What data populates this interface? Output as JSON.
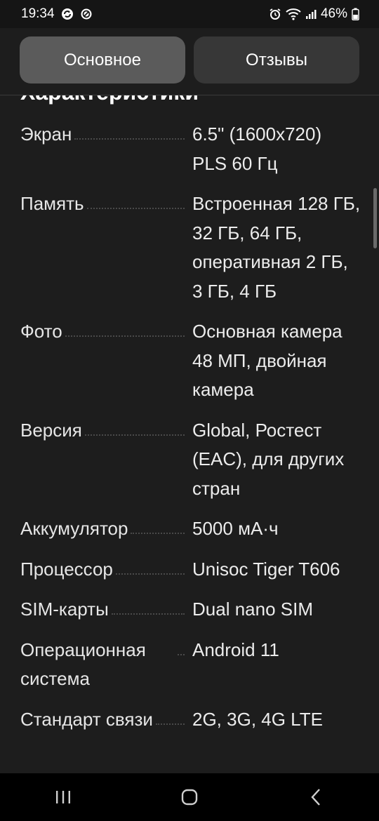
{
  "status_bar": {
    "time": "19:34",
    "battery": "46%",
    "icons": [
      "sync-icon",
      "blocked-icon",
      "alarm-icon",
      "wifi-icon",
      "signal-icon",
      "battery-icon"
    ]
  },
  "tabs": [
    {
      "label": "Основное",
      "active": true
    },
    {
      "label": "Отзывы",
      "active": false
    }
  ],
  "section": {
    "title": "Характеристики"
  },
  "specs": [
    {
      "label": "Экран",
      "value": "6.5\" (1600x720) PLS 60 Гц"
    },
    {
      "label": "Память",
      "value": "Встроенная 128 ГБ, 32 ГБ, 64 ГБ, оперативная 2 ГБ, 3 ГБ, 4 ГБ"
    },
    {
      "label": "Фото",
      "value": "Основная камера 48 МП, двойная камера"
    },
    {
      "label": "Версия",
      "value": "Global, Ростест (EAC), для других стран"
    },
    {
      "label": "Аккумулятор",
      "value": "5000 мА·ч"
    },
    {
      "label": "Процессор",
      "value": "Unisoc Tiger T606"
    },
    {
      "label": "SIM-карты",
      "value": "Dual nano SIM"
    },
    {
      "label": "Операционная система",
      "value": "Android 11"
    },
    {
      "label": "Стандарт связи",
      "value": "2G, 3G, 4G LTE"
    }
  ],
  "nav_bar": {
    "buttons": [
      "recents-icon",
      "home-icon",
      "back-icon"
    ]
  },
  "colors": {
    "background": "#1d1d1d",
    "tab_active": "#5b5b5b",
    "tab_inactive": "#373737",
    "text": "#e9e9e9"
  }
}
